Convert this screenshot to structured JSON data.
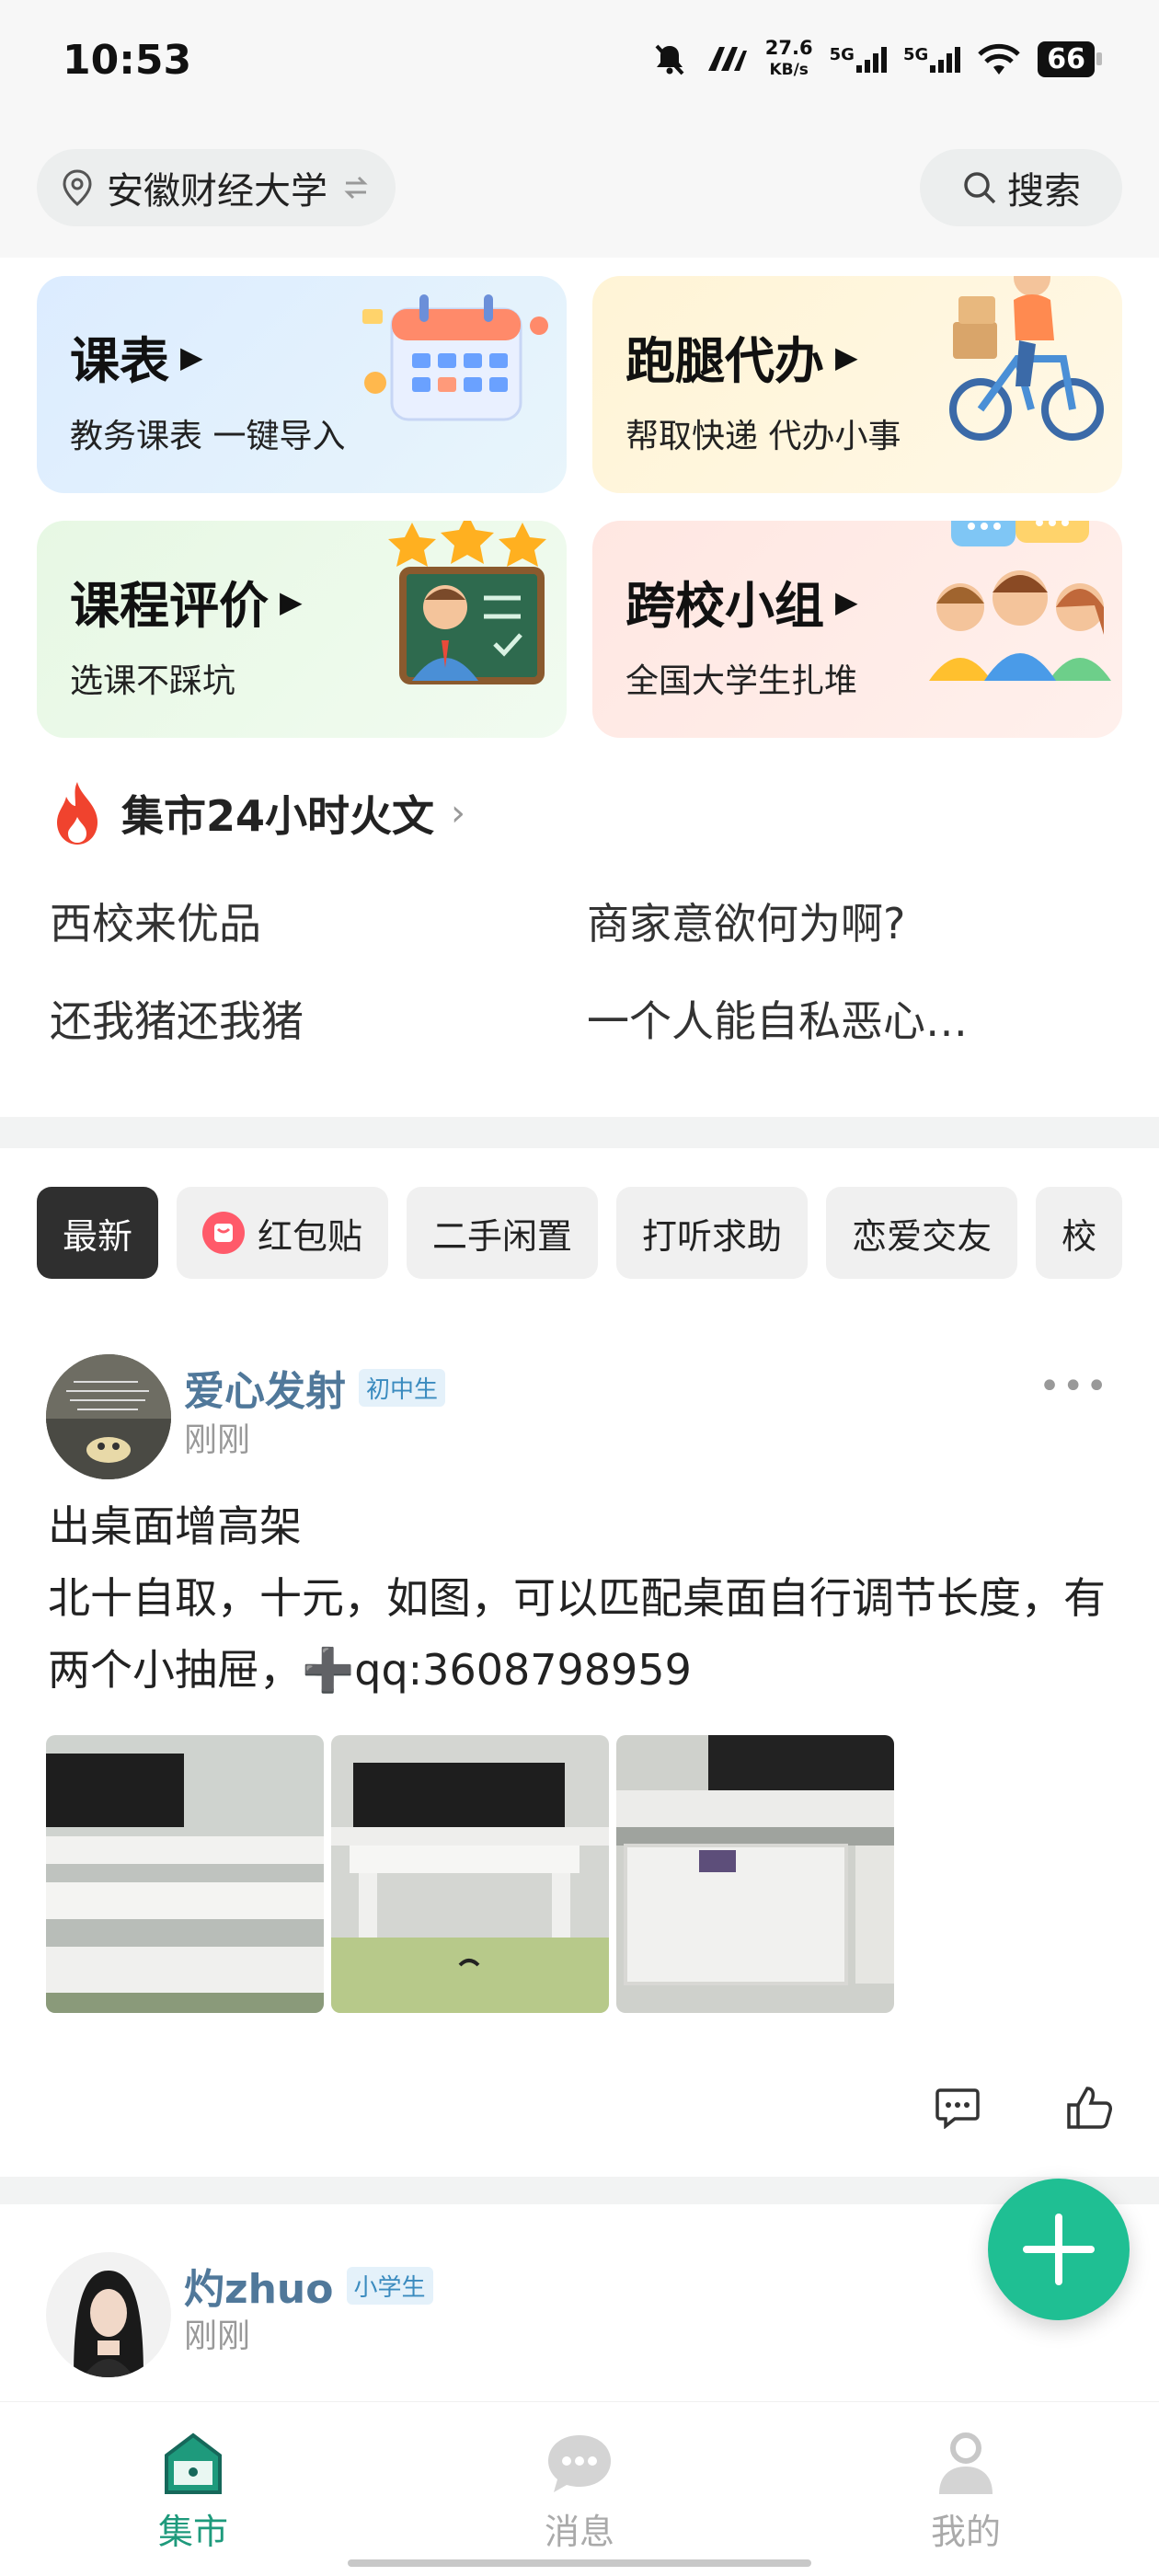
{
  "status_bar": {
    "time": "10:53",
    "net_speed": "27.6",
    "net_unit": "KB/s",
    "sig1": "5G",
    "sig2": "5G",
    "battery": "66"
  },
  "header": {
    "location": "安徽财经大学",
    "search_label": "搜索"
  },
  "cards": [
    {
      "title": "课表",
      "subtitle": "教务课表 一键导入"
    },
    {
      "title": "跑腿代办",
      "subtitle": "帮取快递 代办小事"
    },
    {
      "title": "课程评价",
      "subtitle": "选课不踩坑"
    },
    {
      "title": "跨校小组",
      "subtitle": "全国大学生扎堆"
    }
  ],
  "hot": {
    "title": "集市24小时火文",
    "items": [
      "西校来优品",
      "商家意欲何为啊?",
      "还我猪还我猪",
      "一个人能自私恶心…"
    ]
  },
  "tabs": [
    "最新",
    "红包贴",
    "二手闲置",
    "打听求助",
    "恋爱交友",
    "校"
  ],
  "posts": [
    {
      "user": "爱心发射",
      "badge": "初中生",
      "time": "刚刚",
      "title": "出桌面增高架",
      "body": "北十自取，十元，如图，可以匹配桌面自行调节长度，有两个小抽屉，➕qq:3608798959"
    },
    {
      "user": "灼zhuo",
      "badge": "小学生",
      "time": "刚刚"
    }
  ],
  "nav": [
    "集市",
    "消息",
    "我的"
  ],
  "colors": {
    "accent": "#1fbf93",
    "nav_active": "#1e9a7c",
    "username": "#50789a"
  }
}
